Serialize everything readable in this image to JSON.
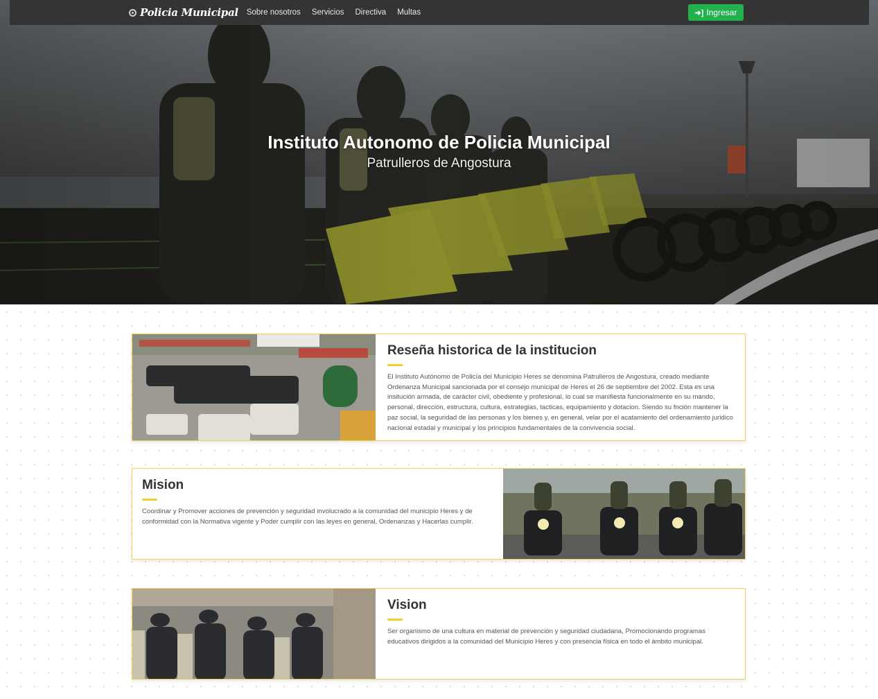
{
  "nav": {
    "brand": "Policia Municipal",
    "brand_icon": "badge-icon",
    "links": [
      "Sobre nosotros",
      "Servicios",
      "Directiva",
      "Multas"
    ],
    "login": {
      "label": "Ingresar",
      "icon": "sign-in-icon",
      "color": "#22b14c"
    }
  },
  "hero": {
    "title": "Instituto Autonomo de Policia Municipal",
    "subtitle": "Patrulleros de Angostura"
  },
  "sections": [
    {
      "title": "Reseña historica de la institucion",
      "text": "El Instituto Autónomo de Policía del Municipio Heres se denomina Patrulleros de Angostura, creado mediante Ordenanza Municipal sancionada por el consejo municipal de Heres el 26 de septiembre del 2002. Esta es una insitución armada, de carácter civil, obediente y profesional, lo cual se manifiesta funcionalmente en su mando, personal, dirección, estructura, cultura, estrategias, tacticas, equipamiento y dotacion. Siendo su fnción mantener la paz social, la seguridad de las personas y los bienes y, en general, velar por el acatamiento del ordenamiento juridico nacional estadal y municipal y los principios fundamentales de la convivencia social."
    },
    {
      "title": "Mision",
      "text": "Coordinar y Promover acciones de prevención y seguridad involucrado a la comunidad del municipio Heres y de conformidad con la Normativa vigente y Poder cumplir con las leyes en general, Ordenanzas y Hacerlas cumplir."
    },
    {
      "title": "Vision",
      "text": "Ser organismo de una cultura en material de prevención y seguridad ciudadana, Promocionando programas educativos dirigidos a la comunidad del Municipio Heres y con presencia física en todo el ámbito municipal."
    }
  ],
  "colors": {
    "accent": "#f2cf2b",
    "navbar": "#343434",
    "card_border": "#f2d35a"
  }
}
